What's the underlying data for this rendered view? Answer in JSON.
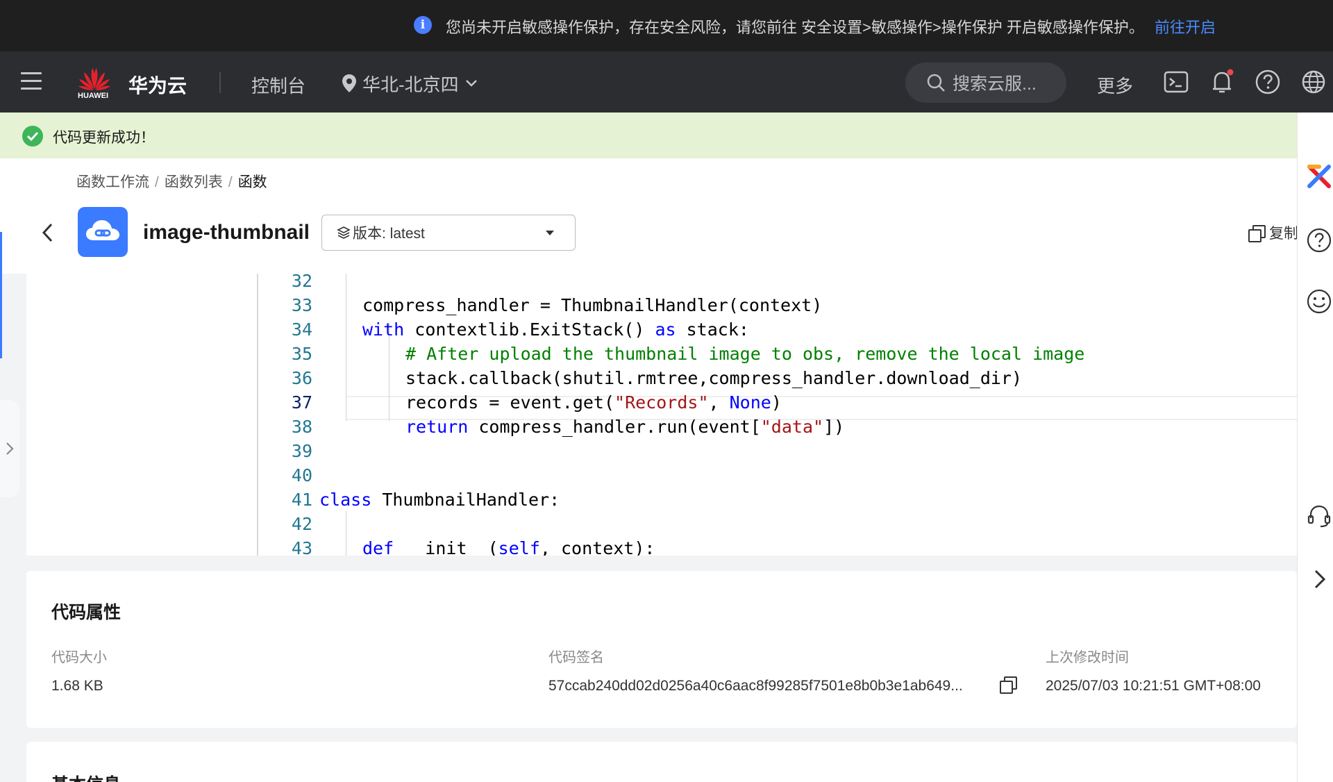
{
  "banner": {
    "message": "您尚未开启敏感操作保护，存在安全风险，请您前往 安全设置>敏感操作>操作保护 开启敏感操作保护。",
    "link": "前往开启"
  },
  "header": {
    "logo_text": "HUAWEI",
    "brand": "华为云",
    "console": "控制台",
    "region": "华北-北京四",
    "search_placeholder": "搜索云服...",
    "more": "更多"
  },
  "notice": {
    "success": "代码更新成功！"
  },
  "breadcrumb": {
    "items": [
      "函数工作流",
      "函数列表",
      "函数"
    ]
  },
  "function": {
    "name": "image-thumbnail",
    "version": "版本: latest",
    "copy_label": "复制"
  },
  "editor": {
    "lines": [
      {
        "n": "32",
        "indent": 0,
        "html": ""
      },
      {
        "n": "33",
        "indent": 1,
        "html": "compress_handler = ThumbnailHandler(context)"
      },
      {
        "n": "34",
        "indent": 1,
        "html": "<span class=\"kw\">with</span> contextlib.ExitStack() <span class=\"kw\">as</span> stack:"
      },
      {
        "n": "35",
        "indent": 2,
        "html": "<span class=\"cm\"># After upload the thumbnail image to obs, remove the local image</span>"
      },
      {
        "n": "36",
        "indent": 2,
        "html": "stack.callback(shutil.rmtree,compress_handler.download_dir)"
      },
      {
        "n": "37",
        "indent": 2,
        "html": "records = event.get(<span class=\"st\">\"Records\"</span>, <span class=\"kw\">None</span>)"
      },
      {
        "n": "38",
        "indent": 2,
        "html": "<span class=\"kw\">return</span> compress_handler.run(event[<span class=\"st\">\"data\"</span>])"
      },
      {
        "n": "39",
        "indent": 0,
        "html": ""
      },
      {
        "n": "40",
        "indent": 0,
        "html": ""
      },
      {
        "n": "41",
        "indent": 0,
        "html": "<span class=\"kw\">class</span> ThumbnailHandler:"
      },
      {
        "n": "42",
        "indent": 0,
        "html": ""
      },
      {
        "n": "43",
        "indent": 1,
        "html": "<span class=\"kw\">def</span> __init__(<span class=\"kw\">self</span>, context):"
      }
    ],
    "active_line": "37"
  },
  "code_properties": {
    "title": "代码属性",
    "size_label": "代码大小",
    "size_value": "1.68 KB",
    "signature_label": "代码签名",
    "signature_value": "57ccab240dd02d0256a40c6aac8f99285f7501e8b0b3e1ab649...",
    "modified_label": "上次修改时间",
    "modified_value": "2025/07/03 10:21:51 GMT+08:00"
  },
  "basic_info": {
    "title": "基本信息"
  },
  "colors": {
    "accent": "#3a7bff",
    "success_bg": "#e5f3d4",
    "header_bg": "#2b2d31",
    "banner_bg": "#1f1f1f"
  }
}
